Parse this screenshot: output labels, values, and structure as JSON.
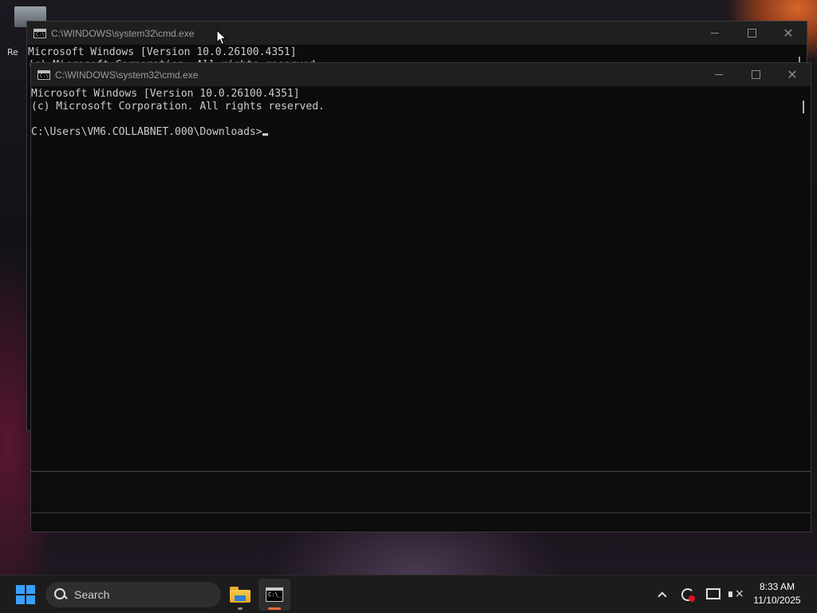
{
  "desktop": {
    "partial_label": "Re"
  },
  "back_window": {
    "title": "C:\\WINDOWS\\system32\\cmd.exe",
    "lines": [
      "Microsoft Windows [Version 10.0.26100.4351]",
      "(c) Microsoft Corporation. All rights reserved."
    ]
  },
  "front_window": {
    "title": "C:\\WINDOWS\\system32\\cmd.exe",
    "line_1": "Microsoft Windows [Version 10.0.26100.4351]",
    "line_2": "(c) Microsoft Corporation. All rights reserved.",
    "line_3": "",
    "prompt": "C:\\Users\\VM6.COLLABNET.000\\Downloads>"
  },
  "taskbar": {
    "search_placeholder": "Search",
    "apps": [
      {
        "name": "File Explorer",
        "icon": "folder-icon"
      },
      {
        "name": "Command Prompt",
        "icon": "cmd-icon",
        "active": true
      }
    ],
    "clock_time": "8:33 AM",
    "clock_date": "11/10/2025",
    "accent_color": "#3aa0ff",
    "active_indicator_color": "#e86a3a"
  }
}
